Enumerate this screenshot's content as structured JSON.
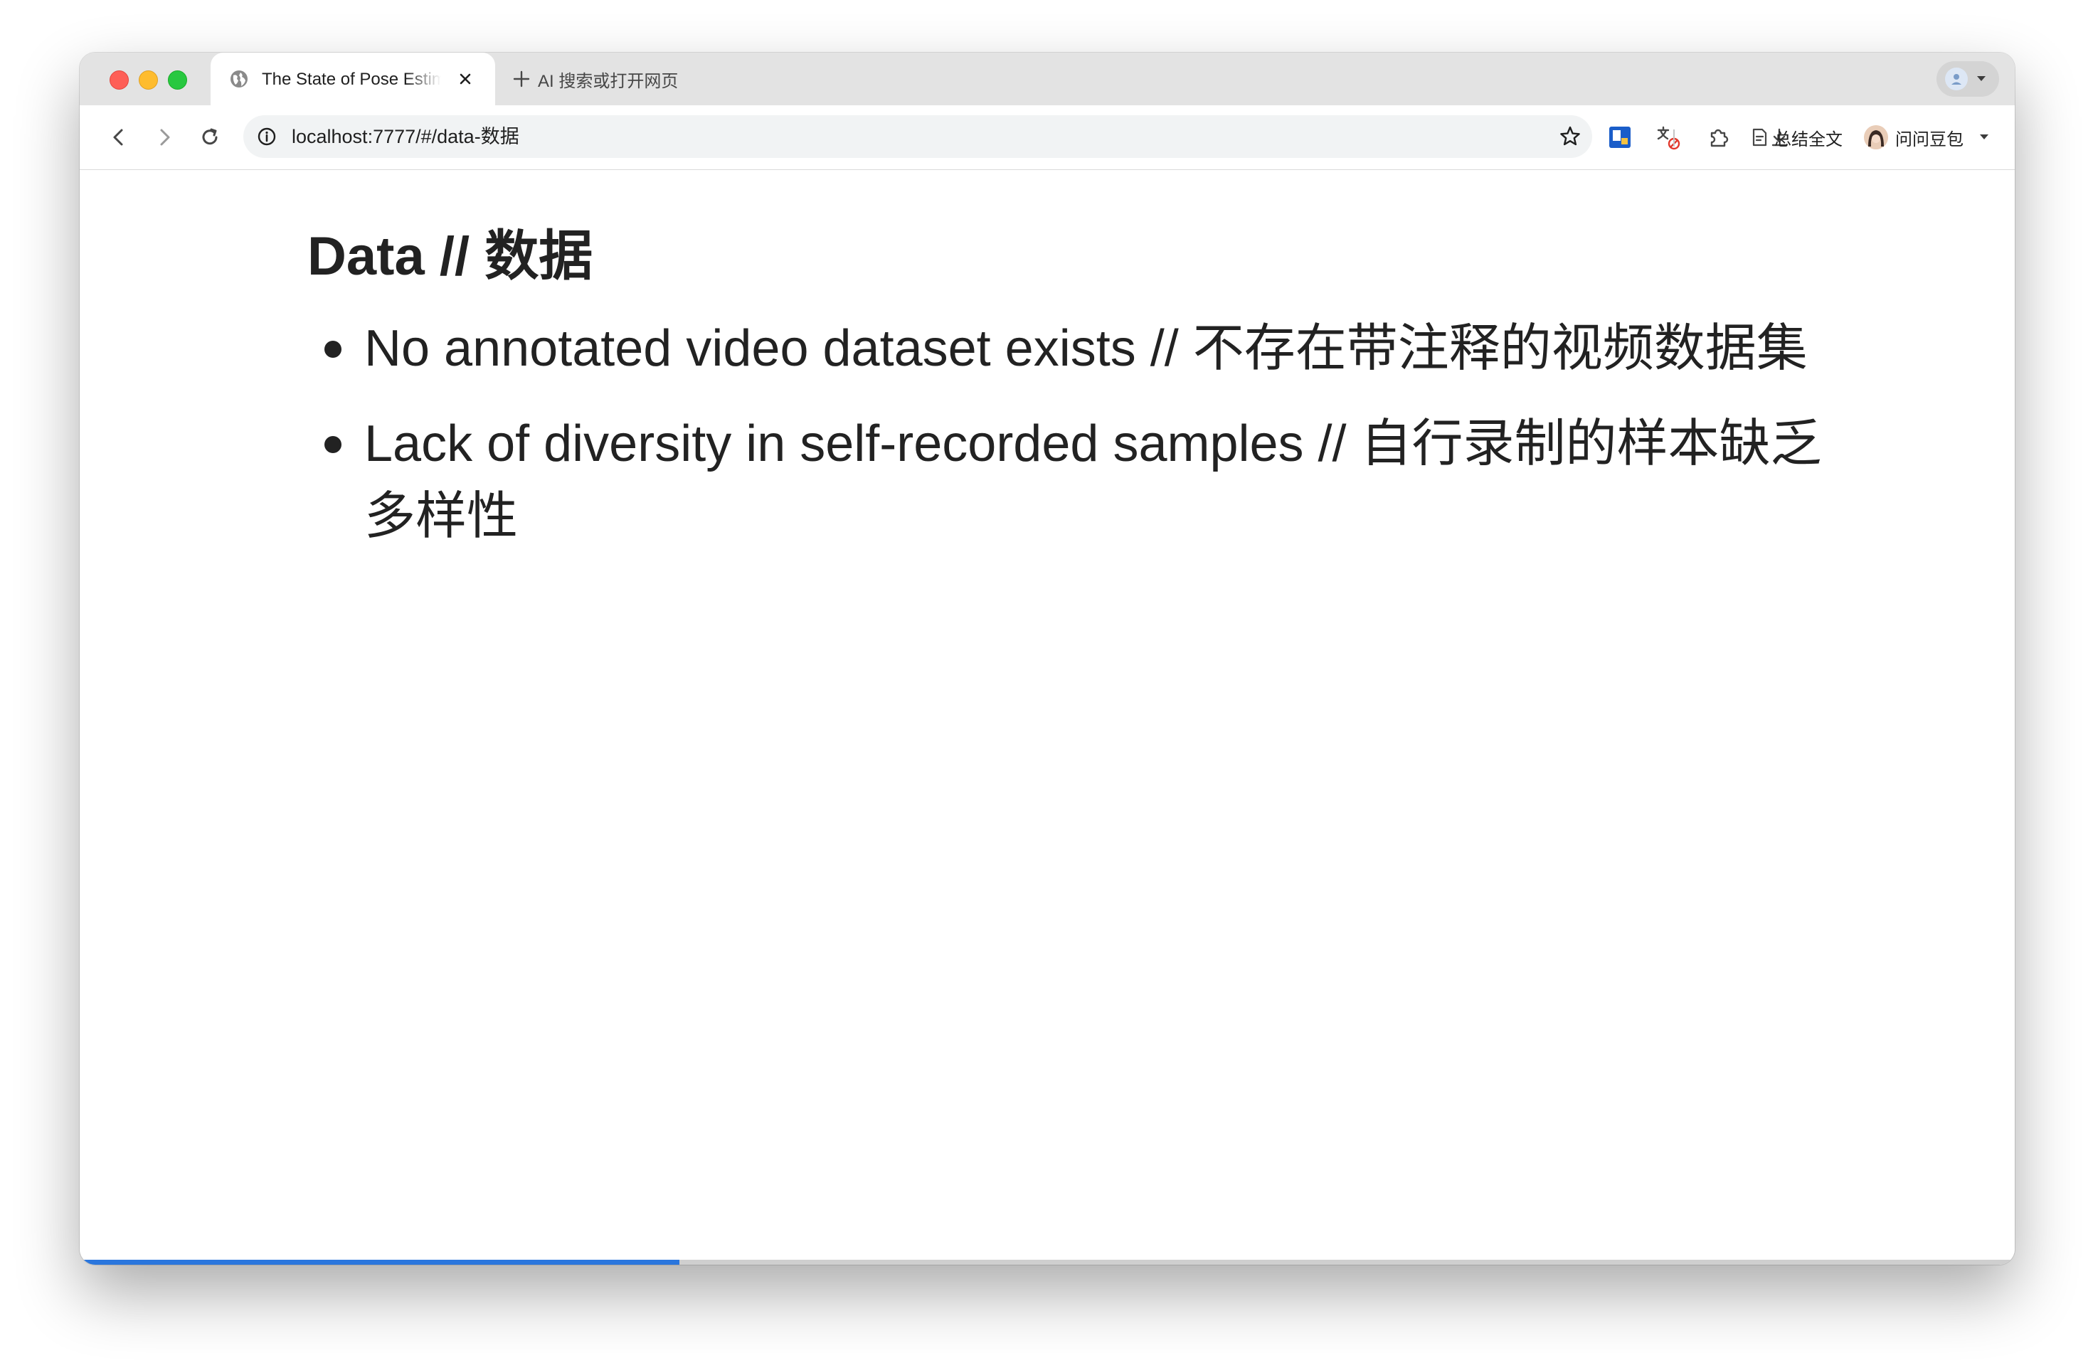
{
  "browser": {
    "tab": {
      "title": "The State of Pose Estimation"
    },
    "new_tab": {
      "label": "AI 搜索或打开网页"
    },
    "address_bar": {
      "url": "localhost:7777/#/data-数据"
    },
    "toolbar": {
      "summarize_label": "总结全文",
      "assistant_label": "问问豆包"
    }
  },
  "slide": {
    "title": "Data // 数据",
    "bullets": [
      {
        "text": "No annotated video dataset exists // 不存在带注释的视频数据集"
      },
      {
        "text": "Lack of diversity in self-recorded samples // 自行录制的样本缺乏多样性"
      }
    ],
    "progress": 0.31
  },
  "colors": {
    "accent": "#2a76dd",
    "text": "#222222",
    "tab_strip": "#e3e3e3"
  },
  "icons": [
    "globe-icon",
    "close-icon",
    "plus-icon",
    "back-icon",
    "forward-icon",
    "reload-icon",
    "info-icon",
    "star-icon",
    "extension-icon",
    "translate-icon",
    "puzzle-icon",
    "download-icon",
    "document-icon",
    "menu-icon"
  ]
}
